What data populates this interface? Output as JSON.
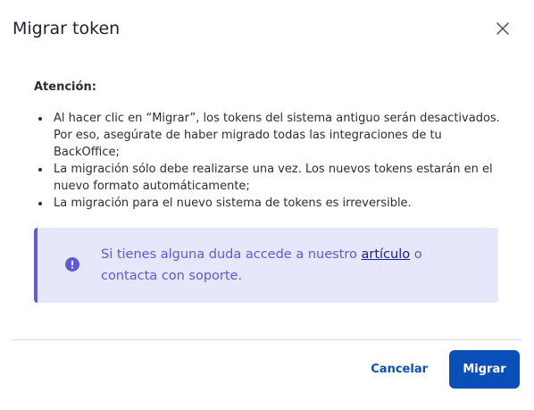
{
  "dialog": {
    "title": "Migrar token",
    "close_icon": "close-icon"
  },
  "content": {
    "attention_label": "Atención:",
    "bullets": [
      "Al hacer clic en “Migrar”, los tokens del sistema antiguo serán desactivados. Por eso, asegúrate de haber migrado todas las integraciones de tu BackOffice;",
      "La migración sólo debe realizarse una vez. Los nuevos tokens estarán en el nuevo formato automáticamente;",
      "La migración para el nuevo sistema de tokens es irreversible."
    ]
  },
  "info_box": {
    "icon": "info-icon",
    "text_before": "Si tienes alguna duda accede a nuestro ",
    "link_label": "artículo",
    "text_after": " o contacta con soporte.",
    "accent_color": "#5f5bd6",
    "background_color": "#e6e7fb"
  },
  "footer": {
    "cancel_label": "Cancelar",
    "primary_label": "Migrar",
    "primary_color": "#0a4fb8"
  }
}
